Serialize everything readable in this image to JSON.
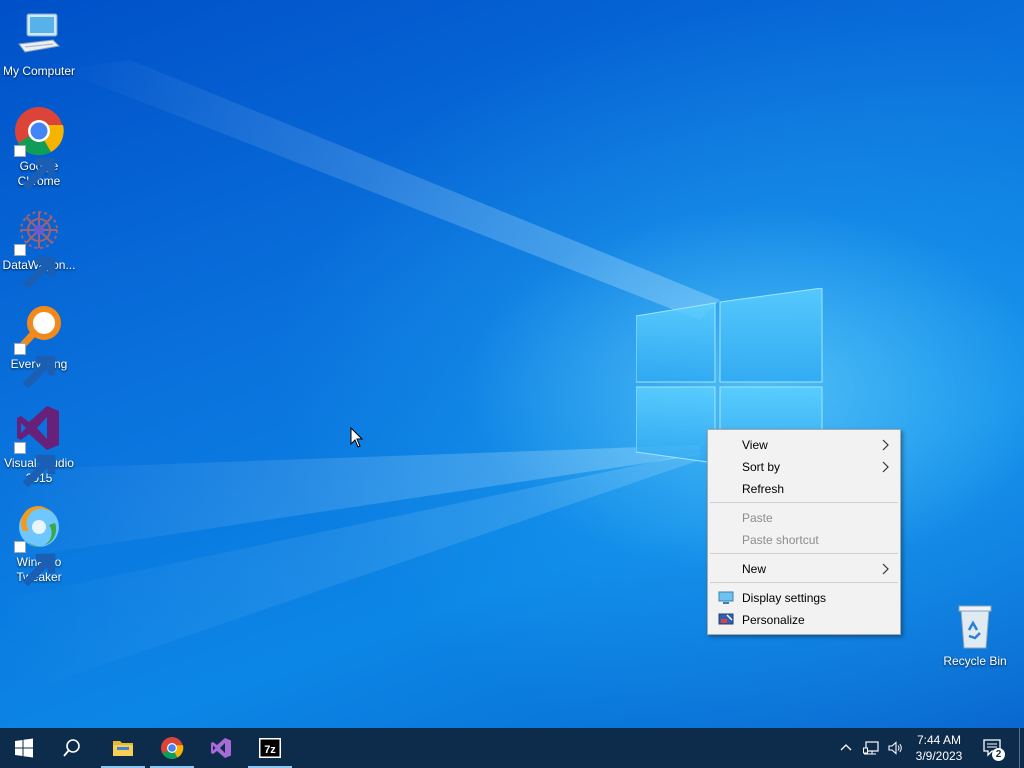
{
  "desktop_icons": [
    {
      "label": "My Computer"
    },
    {
      "label": "Google Chrome"
    },
    {
      "label": "DataWagon..."
    },
    {
      "label": "Everything"
    },
    {
      "label": "Visual Studio 2015"
    },
    {
      "label": "Winaero Tweaker"
    },
    {
      "label": "Recycle Bin"
    }
  ],
  "context_menu": {
    "items": [
      {
        "label": "View"
      },
      {
        "label": "Sort by"
      },
      {
        "label": "Refresh"
      },
      {
        "label": "Paste"
      },
      {
        "label": "Paste shortcut"
      },
      {
        "label": "New"
      },
      {
        "label": "Display settings"
      },
      {
        "label": "Personalize"
      }
    ]
  },
  "taskbar": {
    "pinned": [
      "start-icon",
      "search-icon",
      "file-explorer-icon",
      "chrome-icon",
      "visual-studio-icon",
      "7zip-icon"
    ],
    "clock": {
      "time": "7:44 AM",
      "date": "3/9/2023"
    },
    "notification_count": "2"
  },
  "colors": {
    "taskbar": "#0d2b4b",
    "menu_bg": "#f2f2f2",
    "running_indicator": "#8fc7f3"
  }
}
